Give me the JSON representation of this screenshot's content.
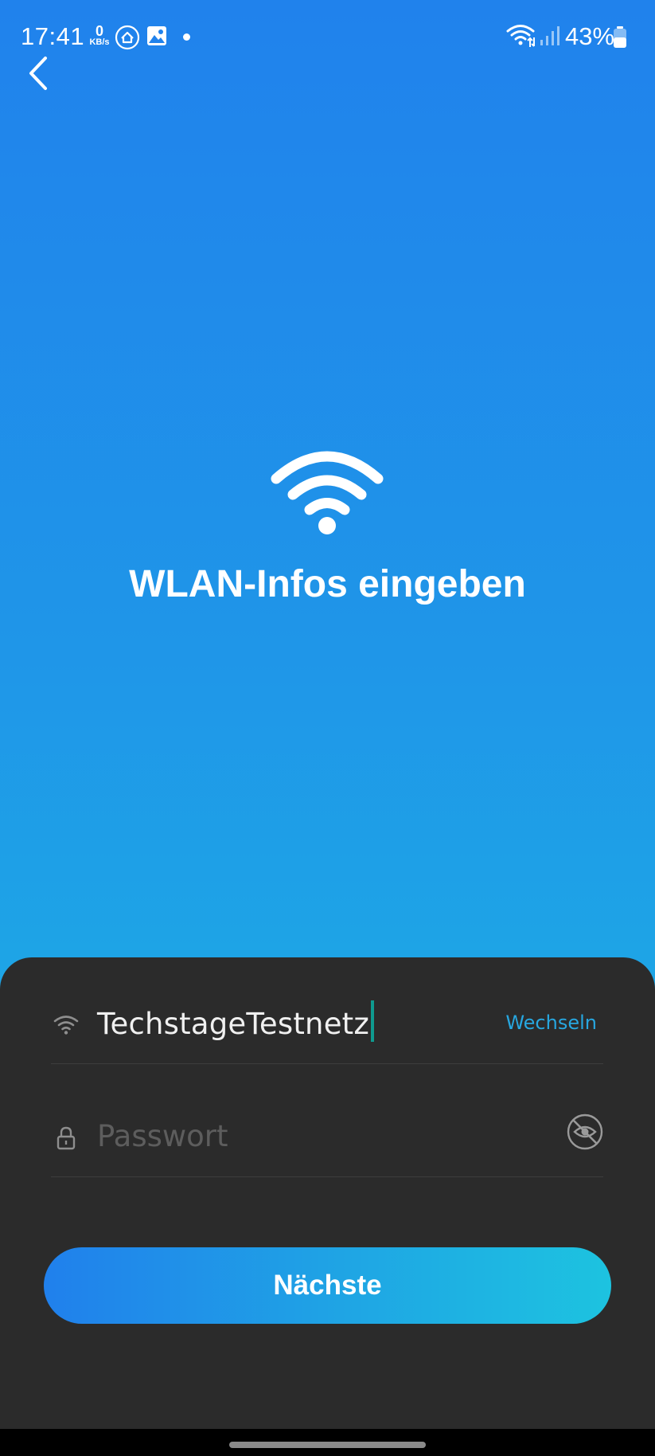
{
  "status_bar": {
    "time": "17:41",
    "net_speed_value": "0",
    "net_speed_unit": "KB/s",
    "battery_percent": "43%"
  },
  "header": {
    "back_icon": "chevron-left-icon"
  },
  "hero": {
    "icon": "wifi-icon",
    "title": "WLAN-Infos eingeben"
  },
  "form": {
    "ssid_value": "TechstageTestnetz",
    "switch_label": "Wechseln",
    "password_placeholder": "Passwort",
    "password_value": ""
  },
  "actions": {
    "next_label": "Nächste"
  },
  "colors": {
    "accent": "#2082ec",
    "link": "#27a7e0",
    "sheet_bg": "#2b2b2b"
  }
}
